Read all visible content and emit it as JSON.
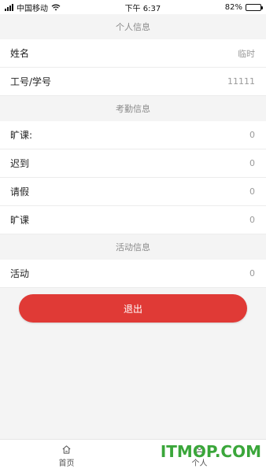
{
  "status_bar": {
    "carrier": "中国移动",
    "time": "下午 6:37",
    "battery": "82%",
    "battery_level": 0.82
  },
  "sections": {
    "personal": {
      "title": "个人信息",
      "rows": [
        {
          "label": "姓名",
          "value": "临时"
        },
        {
          "label": "工号/学号",
          "value": "11111"
        }
      ]
    },
    "attendance": {
      "title": "考勤信息",
      "rows": [
        {
          "label": "旷课:",
          "value": "0"
        },
        {
          "label": "迟到",
          "value": "0"
        },
        {
          "label": "请假",
          "value": "0"
        },
        {
          "label": "旷课",
          "value": "0"
        }
      ]
    },
    "activity": {
      "title": "活动信息",
      "rows": [
        {
          "label": "活动",
          "value": "0"
        }
      ]
    }
  },
  "logout_label": "退出",
  "tabbar": {
    "items": [
      {
        "label": "首页",
        "icon": "home-icon"
      },
      {
        "label": "个人",
        "icon": "person-icon"
      }
    ]
  },
  "watermark": "ITMOP.COM",
  "colors": {
    "accent": "#e03a36",
    "watermark": "#3aa63a"
  }
}
